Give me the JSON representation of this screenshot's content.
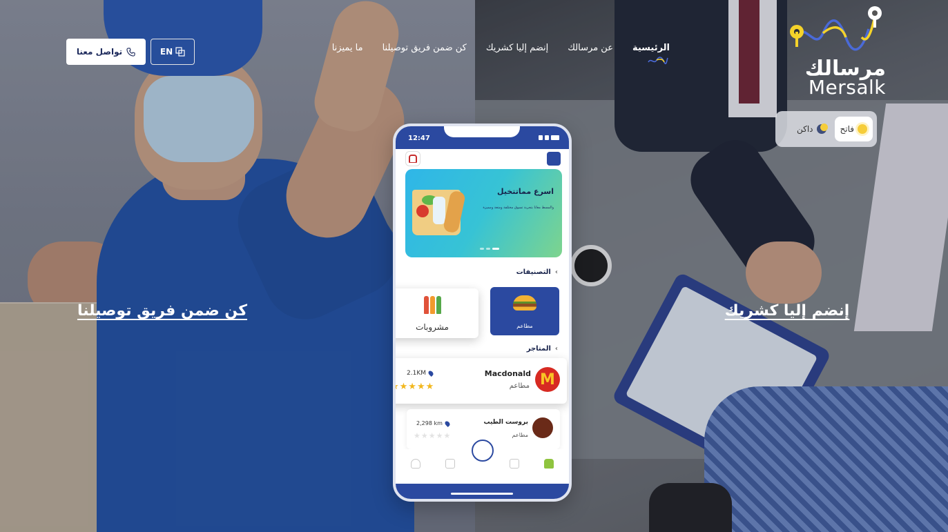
{
  "brand": {
    "name_ar": "مرسالك",
    "name_en": "Mersalk",
    "accent": "#2b49a0",
    "yellow": "#f5d32a"
  },
  "theme_toggle": {
    "light_label": "فاتح",
    "dark_label": "داكن",
    "selected": "light"
  },
  "nav": {
    "items": [
      {
        "label": "الرئيسية",
        "active": true
      },
      {
        "label": "عن مرسالك",
        "active": false
      },
      {
        "label": "إنضم إليا كشريك",
        "active": false
      },
      {
        "label": "كن ضمن فريق توصيلنا",
        "active": false
      },
      {
        "label": "ما يميزنا",
        "active": false
      }
    ]
  },
  "header": {
    "lang_label": "EN",
    "contact_label": "تواصل معنا"
  },
  "hero": {
    "cta_left": "كن ضمن فريق توصيلنا",
    "cta_right": "إنضم إليا كشريك"
  },
  "phone": {
    "time": "12:47",
    "banner_title": "اسرع مماتتخيل",
    "banner_sub": "والمسط معانا بتجربة تسوق مختلفة ومتعة ومميزة",
    "categories_title": "التصنيفات",
    "categories": [
      {
        "label": "مطاعم",
        "icon": "burger-icon"
      },
      {
        "label": "مشروبات",
        "icon": "drinks-icon"
      }
    ],
    "stores_title": "المتاجر",
    "stores": [
      {
        "name": "Macdonald",
        "type": "مطاعم",
        "distance": "2.1KM",
        "rating": 5
      },
      {
        "name": "بروست الطيب",
        "type": "مطاعم",
        "distance": "2,298 km",
        "rating": 0
      }
    ]
  }
}
